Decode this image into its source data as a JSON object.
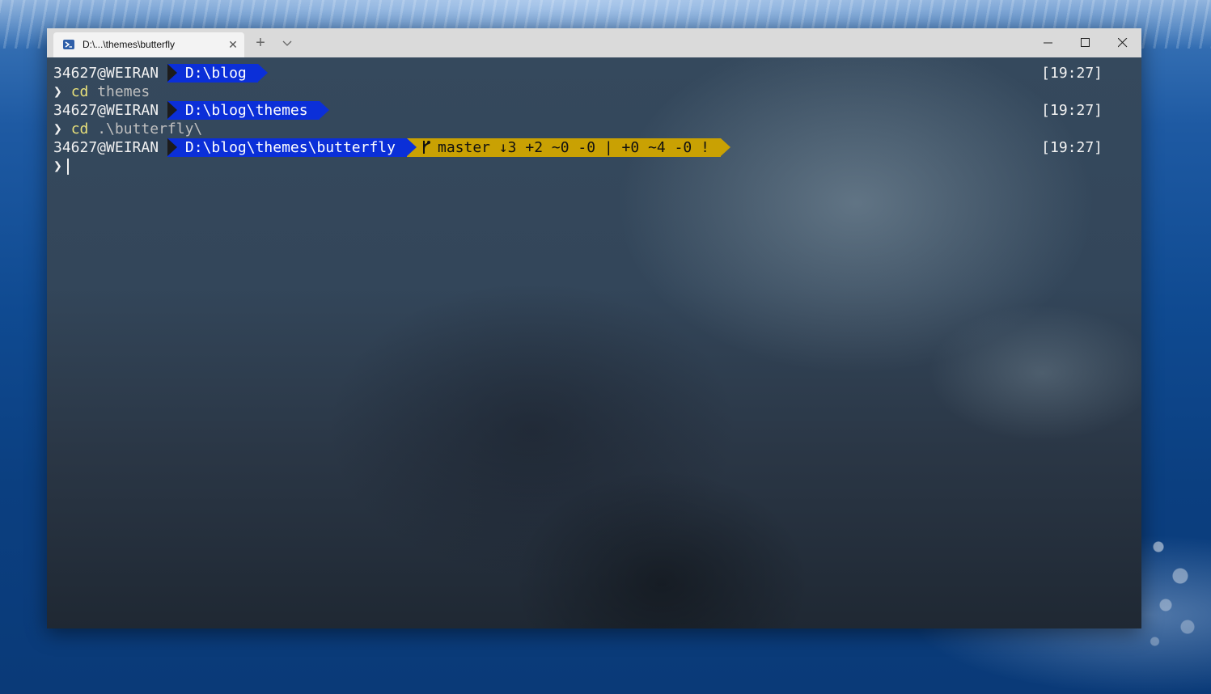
{
  "window": {
    "tab_title": "D:\\...\\themes\\butterfly",
    "tab_icon": "powershell-icon",
    "close_tab_glyph": "✕",
    "new_tab_glyph": "+",
    "dropdown_icon": "chevron-down-icon",
    "minimize_icon": "minimize-icon",
    "maximize_icon": "maximize-icon",
    "close_icon": "close-icon"
  },
  "terminal": {
    "prompt_char": "❯",
    "lines": [
      {
        "user": "34627@WEIRAN",
        "path": "D:\\blog",
        "time": "[19:27]"
      },
      {
        "command": "cd",
        "argument": "themes"
      },
      {
        "user": "34627@WEIRAN",
        "path": "D:\\blog\\themes",
        "time": "[19:27]"
      },
      {
        "command": "cd",
        "argument": ".\\butterfly\\"
      },
      {
        "user": "34627@WEIRAN",
        "path": "D:\\blog\\themes\\butterfly",
        "git_branch_icon": "git-branch-icon",
        "git": "master ↓3 +2 ~0 -0 | +0 ~4 -0 !",
        "time": "[19:27]"
      }
    ]
  },
  "colors": {
    "path_segment": "#0b2fd8",
    "git_segment": "#c9a103",
    "command": "#e8e07a",
    "argument": "#bfbfbf",
    "text": "#f2f2f2"
  }
}
